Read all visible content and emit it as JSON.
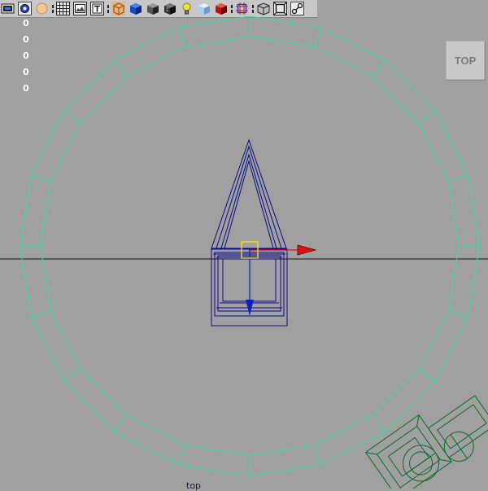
{
  "toolbar": {
    "buttons": [
      "select-camera",
      "lock-camera",
      "camera-attributes",
      "grid-toggle",
      "image-plane",
      "film-gate",
      "isolate-select",
      "xray",
      "wireframe-on-shaded",
      "smooth-shade-all",
      "textured",
      "use-all-lights",
      "shadows",
      "high-quality",
      "resolution-gate",
      "xray-joints",
      "default-quality",
      "safe-action"
    ]
  },
  "hud": {
    "values": [
      "0",
      "0",
      "0",
      "0",
      "0"
    ]
  },
  "view_cube": {
    "label": "TOP"
  },
  "viewport": {
    "camera_label": "top",
    "background_color": "#a0a0a0",
    "colors": {
      "ring": "#33e0a0",
      "selected_mesh": "#0a0a8a",
      "other_mesh": "#0c6a2a",
      "horizon_line": "#111111",
      "manipulator_x": "#e01010",
      "manipulator_z": "#1020c0",
      "pivot": "#e8e020"
    }
  }
}
